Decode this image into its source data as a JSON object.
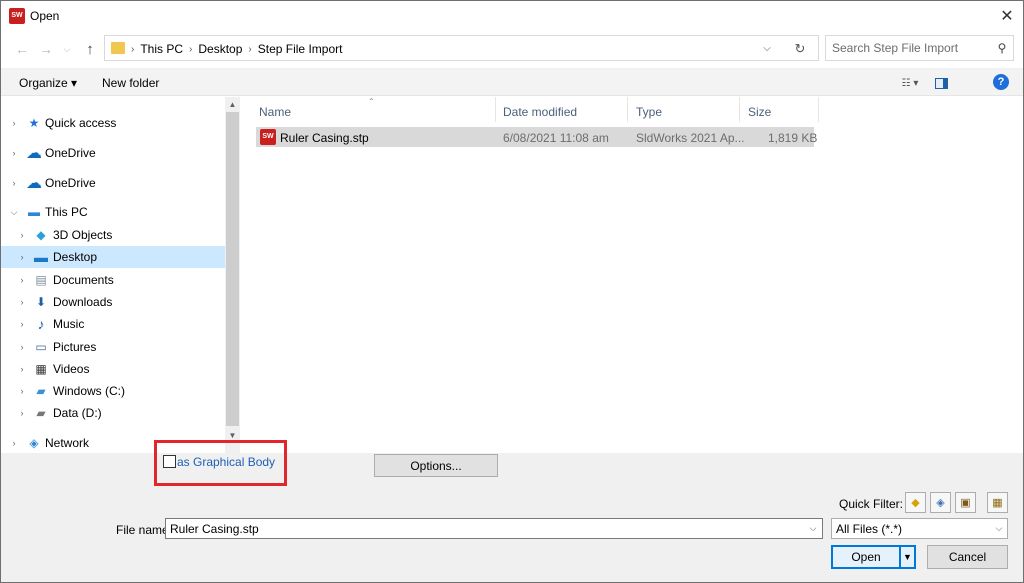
{
  "window": {
    "title": "Open",
    "app_badge": "SW",
    "close": "✕"
  },
  "address": {
    "crumbs": [
      "This PC",
      "Desktop",
      "Step File Import"
    ],
    "search_placeholder": "Search Step File Import"
  },
  "toolbar": {
    "organize": "Organize ▾",
    "new_folder": "New folder",
    "help": "?"
  },
  "nav": {
    "items": [
      {
        "label": "Quick access",
        "icon": "star-icon",
        "color": "#1f73d8"
      },
      {
        "label": "OneDrive",
        "icon": "cloud-icon",
        "color": "#0f6cbd"
      },
      {
        "label": "OneDrive",
        "icon": "cloud-icon",
        "color": "#0f6cbd"
      },
      {
        "label": "This PC",
        "icon": "computer-icon",
        "color": "#2b88d8"
      },
      {
        "label": "3D Objects",
        "icon": "cube-icon",
        "color": "#2e9fdc"
      },
      {
        "label": "Desktop",
        "icon": "desktop-icon",
        "color": "#1c78c9"
      },
      {
        "label": "Documents",
        "icon": "document-icon",
        "color": "#7a8a99"
      },
      {
        "label": "Downloads",
        "icon": "download-icon",
        "color": "#1f5fa5"
      },
      {
        "label": "Music",
        "icon": "music-icon",
        "color": "#1f5fa5"
      },
      {
        "label": "Pictures",
        "icon": "picture-icon",
        "color": "#4a6b8a"
      },
      {
        "label": "Videos",
        "icon": "video-icon",
        "color": "#333333"
      },
      {
        "label": "Windows (C:)",
        "icon": "drive-icon",
        "color": "#3b8fd8"
      },
      {
        "label": "Data (D:)",
        "icon": "drive-icon",
        "color": "#777777"
      },
      {
        "label": "Network",
        "icon": "network-icon",
        "color": "#2b88d8"
      }
    ]
  },
  "columns": {
    "name": "Name",
    "date": "Date modified",
    "type": "Type",
    "size": "Size"
  },
  "files": [
    {
      "name": "Ruler Casing.stp",
      "date": "6/08/2021 11:08 am",
      "type": "SldWorks 2021 Ap...",
      "size": "1,819 KB",
      "badge": "SW"
    }
  ],
  "options": {
    "graphical_body": "as Graphical Body",
    "options_button": "Options..."
  },
  "quick_filter": {
    "label": "Quick Filter:"
  },
  "filename": {
    "label": "File name:",
    "value": "Ruler Casing.stp"
  },
  "filetype": {
    "value": "All Files (*.*)"
  },
  "buttons": {
    "open": "Open",
    "cancel": "Cancel"
  },
  "colors": {
    "accent": "#0078d7",
    "highlight_box": "#e1262c",
    "selected": "#cce8ff",
    "row_selected": "#d9d9d9"
  }
}
